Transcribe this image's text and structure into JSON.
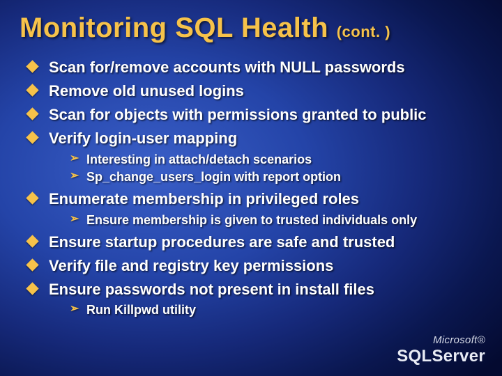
{
  "title": {
    "main": "Monitoring SQL Health",
    "cont": "(cont. )"
  },
  "bullets": [
    {
      "text": "Scan for/remove accounts with NULL passwords"
    },
    {
      "text": "Remove old unused logins"
    },
    {
      "text": "Scan for objects with permissions granted to public"
    },
    {
      "text": "Verify login-user mapping",
      "sub": [
        "Interesting in attach/detach scenarios",
        "Sp_change_users_login with report option"
      ]
    },
    {
      "text": "Enumerate membership in privileged roles",
      "sub": [
        "Ensure membership is given to trusted individuals only"
      ]
    },
    {
      "text": "Ensure startup procedures are safe and trusted"
    },
    {
      "text": "Verify file and registry key permissions"
    },
    {
      "text": "Ensure passwords not present in install files",
      "sub": [
        "Run Killpwd utility"
      ]
    }
  ],
  "logo": {
    "brand": "Microsoft®",
    "product": "SQLServer"
  }
}
